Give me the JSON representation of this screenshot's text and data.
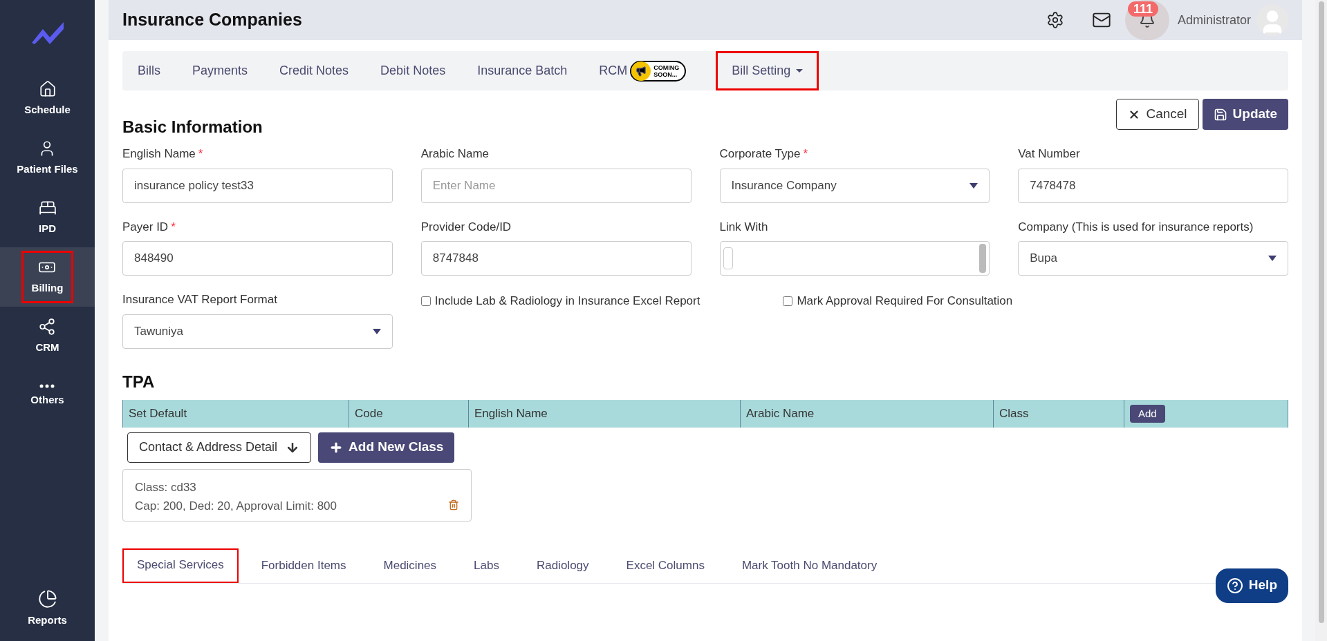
{
  "sidebar": {
    "items": [
      {
        "label": "Schedule",
        "selected": false,
        "highlighted": false
      },
      {
        "label": "Patient Files",
        "selected": false,
        "highlighted": false
      },
      {
        "label": "IPD",
        "selected": false,
        "highlighted": false
      },
      {
        "label": "Billing",
        "selected": true,
        "highlighted": true
      },
      {
        "label": "CRM",
        "selected": false,
        "highlighted": false
      },
      {
        "label": "Others",
        "selected": false,
        "highlighted": false
      }
    ],
    "bottom_item": {
      "label": "Reports"
    }
  },
  "header": {
    "title": "Insurance Companies",
    "notification_count": "111",
    "user": "Administrator"
  },
  "top_tabs": [
    {
      "label": "Bills",
      "kind": "plain",
      "highlighted": false
    },
    {
      "label": "Payments",
      "kind": "plain",
      "highlighted": false
    },
    {
      "label": "Credit Notes",
      "kind": "plain",
      "highlighted": false
    },
    {
      "label": "Debit Notes",
      "kind": "plain",
      "highlighted": false
    },
    {
      "label": "Insurance Batch",
      "kind": "plain",
      "highlighted": false
    },
    {
      "label": "RCM",
      "kind": "badge",
      "badge": [
        "COMING",
        "SOON..."
      ],
      "highlighted": false
    },
    {
      "label": "Bill Setting",
      "kind": "dropdown",
      "highlighted": true
    }
  ],
  "actions": {
    "cancel": "Cancel",
    "update": "Update"
  },
  "basic_information": {
    "title": "Basic Information",
    "fields": [
      {
        "label": "English Name",
        "required_mark": "*",
        "kind": "text",
        "value": "insurance policy test33"
      },
      {
        "label": "Arabic Name",
        "kind": "text",
        "placeholder": "Enter Name"
      },
      {
        "label": "Corporate Type",
        "required_mark": "*",
        "kind": "select",
        "value": "Insurance Company"
      },
      {
        "label": "Vat Number",
        "kind": "text",
        "value": "7478478"
      },
      {
        "label": "Payer ID",
        "required_mark": "*",
        "kind": "text",
        "value": "848490"
      },
      {
        "label": "Provider Code/ID",
        "kind": "text",
        "value": "8747848"
      },
      {
        "label": "Link With",
        "kind": "multiselect"
      },
      {
        "label": "Company (This is used for insurance reports)",
        "kind": "select",
        "value": "Bupa"
      },
      {
        "label": "Insurance VAT Report Format",
        "kind": "select",
        "value": "Tawuniya"
      },
      {
        "label": "Include Lab & Radiology in Insurance Excel Report",
        "kind": "checkbox",
        "checked": false
      },
      {
        "label": "Mark Approval Required For Consultation",
        "kind": "checkbox",
        "checked": false
      }
    ]
  },
  "tpa": {
    "title": "TPA",
    "columns": [
      "Set Default",
      "Code",
      "English Name",
      "Arabic Name",
      "Class"
    ],
    "add_button": "Add"
  },
  "contact_button": "Contact & Address Detail",
  "add_class_button": "Add New Class",
  "class_card": {
    "lines": [
      "Class: cd33",
      "Cap: 200, Ded: 20, Approval Limit: 800"
    ]
  },
  "bottom_tabs": [
    {
      "label": "Special Services",
      "selected": true,
      "highlighted": true
    },
    {
      "label": "Forbidden Items",
      "selected": false,
      "highlighted": false
    },
    {
      "label": "Medicines",
      "selected": false,
      "highlighted": false
    },
    {
      "label": "Labs",
      "selected": false,
      "highlighted": false
    },
    {
      "label": "Radiology",
      "selected": false,
      "highlighted": false
    },
    {
      "label": "Excel Columns",
      "selected": false,
      "highlighted": false
    },
    {
      "label": "Mark Tooth No Mandatory",
      "selected": false,
      "highlighted": false
    }
  ],
  "help_button": "Help"
}
